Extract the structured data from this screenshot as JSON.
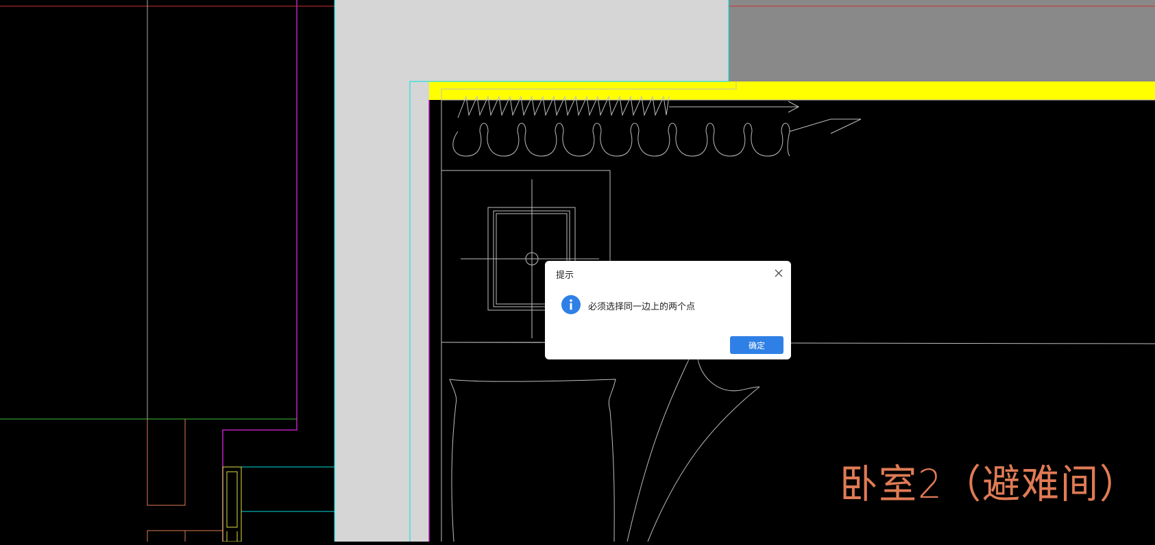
{
  "drawing": {
    "room_label": "卧室2（避难间）",
    "colors": {
      "background": "#000000",
      "wall_fill": "#d6d6d6",
      "dark_fill": "#898989",
      "yellow_wall": "#ffff00",
      "cyan_line": "#00e0e0",
      "magenta_line": "#c020c0",
      "red_line": "#d03030",
      "green_line": "#40c040",
      "orange_line": "#e07b55",
      "white_line": "#bfbfbf",
      "yellow_line": "#e0e040"
    }
  },
  "dialog": {
    "title": "提示",
    "message": "必须选择同一边上的两个点",
    "ok_label": "确定",
    "icons": {
      "close": "close-icon",
      "info": "info-icon"
    },
    "colors": {
      "info_icon": "#2f80e6",
      "ok_button": "#2f80e6"
    }
  }
}
